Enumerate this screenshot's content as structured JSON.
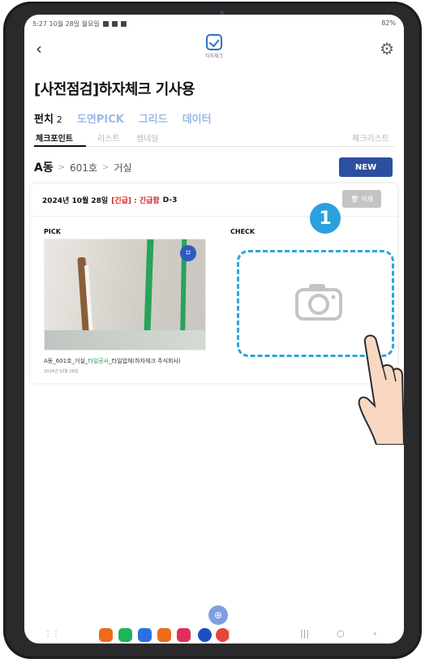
{
  "status": {
    "time_date": "5:27  10월 28일 월요일",
    "right": "82%"
  },
  "header": {
    "logo_text": "하자체크"
  },
  "page": {
    "title": "[사전점검]하자체크 기사용"
  },
  "tabs": [
    {
      "label": "펀치",
      "count": "2"
    },
    {
      "label": "도면PICK"
    },
    {
      "label": "그리드"
    },
    {
      "label": "데이터"
    }
  ],
  "subtabs": [
    {
      "label": "체크포인트"
    },
    {
      "label": "리스트"
    },
    {
      "label": "썸네일"
    },
    {
      "label": "체크리스트"
    }
  ],
  "breadcrumb": {
    "building": "A동",
    "unit": "601호",
    "room": "거실"
  },
  "new_button": "NEW",
  "card": {
    "date": "2024년 10월 28일",
    "urgent": "[긴급] : 긴급함",
    "dday": "D-3",
    "delete_label": "삭제",
    "pick_label": "PICK",
    "check_label": "CHECK",
    "caption_prefix": "A동_601호_거실_",
    "caption_green": "타일공사",
    "caption_suffix": "_타일업체(하자체크 주식회사)",
    "caption_date": "2024년 10월 28일"
  },
  "annotation": {
    "step": "1"
  },
  "icons": {
    "accent": "#2d4fa0",
    "dashed": "#2aa6df",
    "urgent": "#d82020"
  }
}
